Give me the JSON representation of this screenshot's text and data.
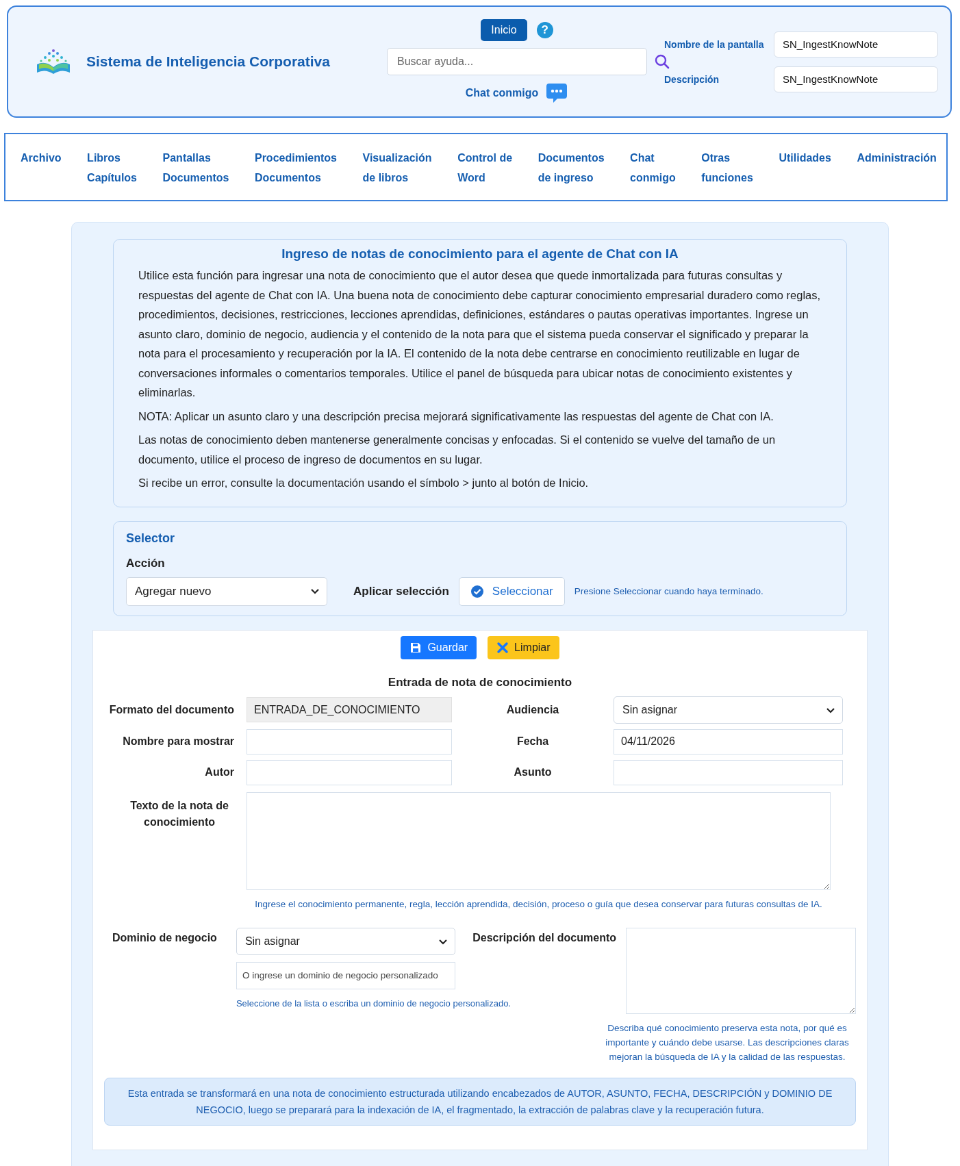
{
  "header": {
    "app_title": "Sistema de Inteligencia Corporativa",
    "home_button": "Inicio",
    "help_symbol": "?",
    "search": {
      "placeholder": "Buscar ayuda..."
    },
    "chat_link": "Chat conmigo",
    "screen_name": {
      "label": "Nombre de la pantalla",
      "value": "SN_IngestKnowNote"
    },
    "description": {
      "label": "Descripción",
      "value": "SN_IngestKnowNote"
    }
  },
  "nav": [
    {
      "lines": [
        "Archivo"
      ]
    },
    {
      "lines": [
        "Libros",
        "Capítulos"
      ]
    },
    {
      "lines": [
        "Pantallas",
        "Documentos"
      ]
    },
    {
      "lines": [
        "Procedimientos",
        "Documentos"
      ]
    },
    {
      "lines": [
        "Visualización",
        "de libros"
      ]
    },
    {
      "lines": [
        "Control de",
        "Word"
      ]
    },
    {
      "lines": [
        "Documentos",
        "de ingreso"
      ]
    },
    {
      "lines": [
        "Chat",
        "conmigo"
      ]
    },
    {
      "lines": [
        "Otras",
        "funciones"
      ]
    },
    {
      "lines": [
        "Utilidades"
      ]
    },
    {
      "lines": [
        "Administración"
      ]
    }
  ],
  "info": {
    "title": "Ingreso de notas de conocimiento para el agente de Chat con IA",
    "paragraphs": [
      "Utilice esta función para ingresar una nota de conocimiento que el autor desea que quede inmortalizada para futuras consultas y respuestas del agente de Chat con IA. Una buena nota de conocimiento debe capturar conocimiento empresarial duradero como reglas, procedimientos, decisiones, restricciones, lecciones aprendidas, definiciones, estándares o pautas operativas importantes. Ingrese un asunto claro, dominio de negocio, audiencia y el contenido de la nota para que el sistema pueda conservar el significado y preparar la nota para el procesamiento y recuperación por la IA. El contenido de la nota debe centrarse en conocimiento reutilizable en lugar de conversaciones informales o comentarios temporales. Utilice el panel de búsqueda para ubicar notas de conocimiento existentes y eliminarlas.",
      "NOTA: Aplicar un asunto claro y una descripción precisa mejorará significativamente las respuestas del agente de Chat con IA.",
      "Las notas de conocimiento deben mantenerse generalmente concisas y enfocadas. Si el contenido se vuelve del tamaño de un documento, utilice el proceso de ingreso de documentos en su lugar.",
      "Si recibe un error, consulte la documentación usando el símbolo > junto al botón de Inicio."
    ]
  },
  "selector": {
    "title": "Selector",
    "action_label": "Acción",
    "action_value": "Agregar nuevo",
    "apply_label": "Aplicar selección",
    "select_button": "Seleccionar",
    "hint": "Presione Seleccionar cuando haya terminado."
  },
  "form": {
    "buttons": [
      {
        "kind": "save",
        "label": "Guardar"
      },
      {
        "kind": "clear",
        "label": "Limpiar"
      }
    ],
    "title": "Entrada de nota de conocimiento",
    "fields": [
      {
        "kind": "readonly",
        "label": "Formato del documento",
        "value": "ENTRADA_DE_CONOCIMIENTO"
      },
      {
        "kind": "select",
        "label": "Audiencia",
        "value": "Sin asignar"
      },
      {
        "kind": "text",
        "label": "Nombre para mostrar"
      },
      {
        "kind": "text",
        "label": "Fecha",
        "value": "04/11/2026"
      },
      {
        "kind": "text",
        "label": "Autor"
      },
      {
        "kind": "text",
        "label": "Asunto"
      }
    ],
    "note_text": {
      "label": "Texto de la nota de conocimiento",
      "hint": "Ingrese el conocimiento permanente, regla, lección aprendida, decisión, proceso o guía que desea conservar para futuras consultas de IA."
    },
    "business_domain": {
      "label": "Dominio de negocio",
      "value": "Sin asignar",
      "custom_placeholder": "O ingrese un dominio de negocio personalizado",
      "hint": "Seleccione de la lista o escriba un dominio de negocio personalizado."
    },
    "doc_description": {
      "label": "Descripción del documento",
      "hint": "Describa qué conocimiento preserva esta nota, por qué es importante y cuándo debe usarse. Las descripciones claras mejoran la búsqueda de IA y la calidad de las respuestas."
    },
    "footer_note": "Esta entrada se transformará en una nota de conocimiento estructurada utilizando encabezados de AUTOR, ASUNTO, FECHA, DESCRIPCIÓN y DOMINIO DE NEGOCIO, luego se preparará para la indexación de IA, el fragmentado, la extracción de palabras clave y la recuperación futura."
  }
}
